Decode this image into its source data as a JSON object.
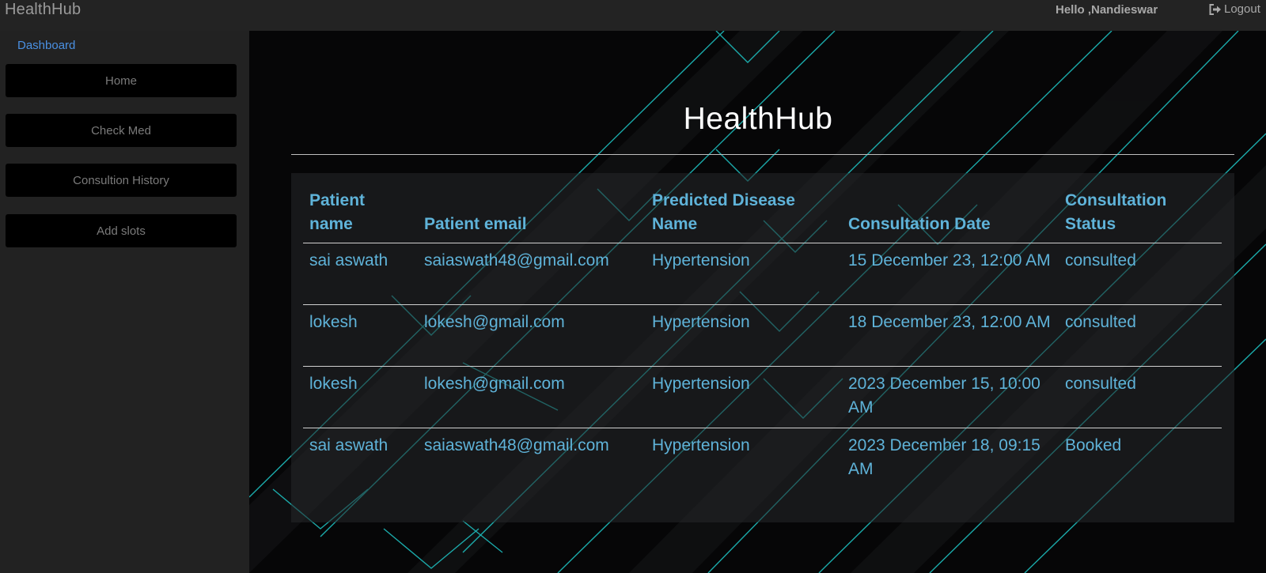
{
  "header": {
    "brand": "HealthHub",
    "greeting": "Hello ,Nandieswar",
    "logout_label": "Logout"
  },
  "sidebar": {
    "heading": "Dashboard",
    "items": [
      {
        "label": "Home"
      },
      {
        "label": "Check Med"
      },
      {
        "label": "Consultion History"
      },
      {
        "label": "Add slots"
      }
    ]
  },
  "main": {
    "title": "HealthHub",
    "table": {
      "columns": [
        "Patient name",
        "Patient email",
        "Predicted Disease Name",
        "Consultation Date",
        "Consultation Status"
      ],
      "rows": [
        [
          "sai aswath",
          "saiaswath48@gmail.com",
          "Hypertension",
          "15 December 23, 12:00 AM",
          "consulted"
        ],
        [
          "lokesh",
          "lokesh@gmail.com",
          "Hypertension",
          "18 December 23, 12:00 AM",
          "consulted"
        ],
        [
          "lokesh",
          "lokesh@gmail.com",
          "Hypertension",
          "2023 December 15, 10:00 AM",
          "consulted"
        ],
        [
          "sai aswath",
          "saiaswath48@gmail.com",
          "Hypertension",
          "2023 December 18, 09:15 AM",
          "Booked"
        ]
      ]
    }
  },
  "colors": {
    "accent_text": "#5fb3d9",
    "dashboard_link": "#4a90e2",
    "neon_lines": "#1fc7c7",
    "button_bg": "#000000"
  },
  "icons": {
    "logout": "sign-out-icon"
  }
}
